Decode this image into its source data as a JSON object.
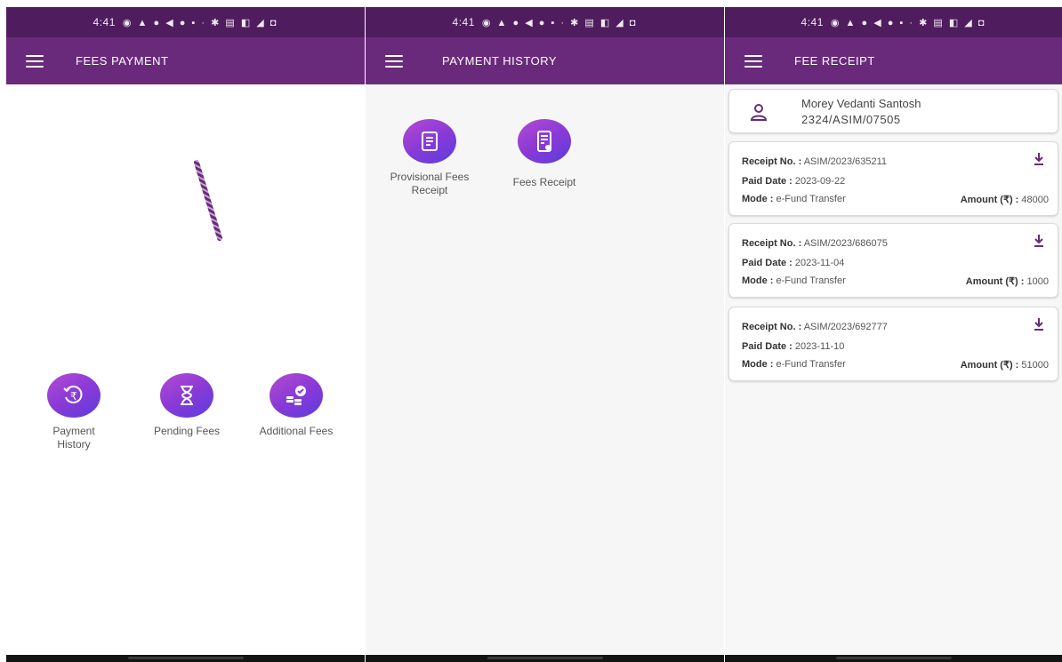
{
  "status_bar": {
    "time": "4:41",
    "icons": "◉ ▲ ● ◀ ● ▪ · ✱ ▤ ◧ ◢ ◘"
  },
  "screens": {
    "fees_payment": {
      "title": "FEES PAYMENT",
      "tiles": [
        {
          "label": "Payment History",
          "icon": "rupee-refresh-icon"
        },
        {
          "label": "Pending Fees",
          "icon": "hourglass-icon"
        },
        {
          "label": "Additional Fees",
          "icon": "coins-check-icon"
        }
      ]
    },
    "payment_history": {
      "title": "PAYMENT HISTORY",
      "tiles": [
        {
          "label": "Provisional Fees Receipt",
          "icon": "document-icon"
        },
        {
          "label": "Fees Receipt",
          "icon": "receipt-icon"
        }
      ]
    },
    "fee_receipt": {
      "title": "FEE RECEIPT",
      "student": {
        "name": "Morey Vedanti Santosh",
        "id": "2324/ASIM/07505"
      },
      "labels": {
        "receipt_no": "Receipt No. :",
        "paid_date": "Paid Date :",
        "mode": "Mode :",
        "amount": "Amount (₹) :"
      },
      "receipts": [
        {
          "receipt_no": "ASIM/2023/635211",
          "paid_date": "2023-09-22",
          "mode": "e-Fund Transfer",
          "amount": "48000"
        },
        {
          "receipt_no": "ASIM/2023/686075",
          "paid_date": "2023-11-04",
          "mode": "e-Fund Transfer",
          "amount": "1000"
        },
        {
          "receipt_no": "ASIM/2023/692777",
          "paid_date": "2023-11-10",
          "mode": "e-Fund Transfer",
          "amount": "51000"
        }
      ]
    }
  },
  "colors": {
    "app_bar": "#6a2a7c",
    "status_bar": "#4f1d5d",
    "accent_start": "#b34bd4",
    "accent_end": "#5a3de0"
  }
}
